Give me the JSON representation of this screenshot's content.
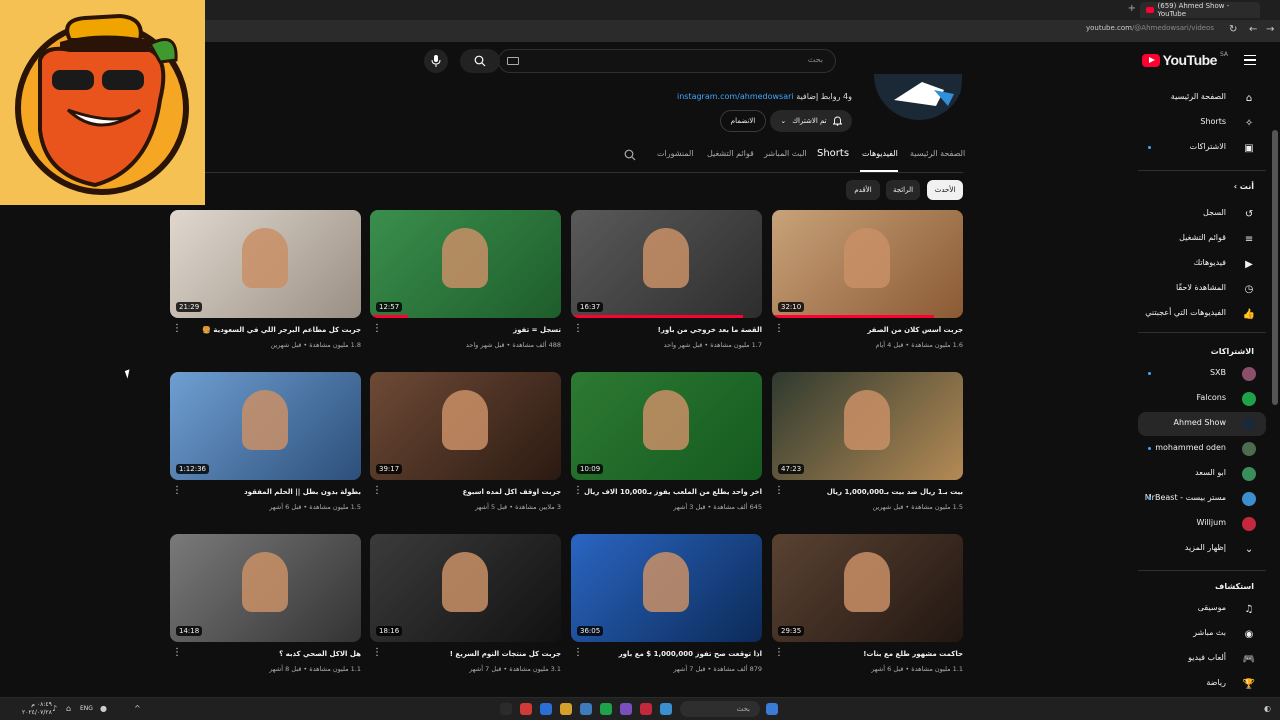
{
  "browser": {
    "tab_title": "(659) Ahmed Show - YouTube",
    "url_host": "youtube.com",
    "url_path": "/@Ahmedowsari/videos"
  },
  "masthead": {
    "logo_text": "YouTube",
    "logo_region": "SA",
    "search_placeholder": "بحث"
  },
  "channel": {
    "links_prefix": "و4 روابط إضافية",
    "link": "instagram.com/ahmedowsari",
    "subscribed_label": "تم الاشتراك",
    "join_label": "الانضمام"
  },
  "tabs": {
    "home": "الصفحة الرئيسية",
    "videos": "الفيديوهات",
    "shorts": "Shorts",
    "live": "البث المباشر",
    "playlists": "قوائم التشغيل",
    "posts": "المنشورات"
  },
  "chips": {
    "latest": "الأحدث",
    "popular": "الرائجة",
    "oldest": "الأقدم"
  },
  "colors": {
    "background": "#0f0f0f",
    "accent_red": "#ff0033",
    "link_blue": "#3ea6ff",
    "chip_bg": "#272727"
  },
  "videos": [
    {
      "title": "جربت أسس كلان من الصفر",
      "meta": "1.6 مليون مشاهدة • قبل 4 أيام",
      "duration": "32:10",
      "progress": 0.85
    },
    {
      "title": "القصة ما بعد خروجي من باور!",
      "meta": "1.7 مليون مشاهدة • قبل شهر واحد",
      "duration": "16:37",
      "progress": 0.9
    },
    {
      "title": "تسجل = تفوز",
      "meta": "488 ألف مشاهدة • قبل شهر واحد",
      "duration": "12:57",
      "progress": 0.2
    },
    {
      "title": "جربت كل مطاعم البرجر اللي في السعودية 🍔",
      "meta": "1.8 مليون مشاهدة • قبل شهرين",
      "duration": "21:29",
      "progress": 0.0
    },
    {
      "title": "بيت بـ1 ريال ضد بيت بـ1,000,000 ريال",
      "meta": "1.5 مليون مشاهدة • قبل شهرين",
      "duration": "47:23",
      "progress": 0.0
    },
    {
      "title": "آخر واحد يطلع من الملعب يفوز بـ10,000 آلاف ريال",
      "meta": "645 ألف مشاهدة • قبل 3 أشهر",
      "duration": "10:09",
      "progress": 0.0
    },
    {
      "title": "جربت اوقف اكل لمده اسبوع",
      "meta": "3 ملايين مشاهدة • قبل 5 أشهر",
      "duration": "39:17",
      "progress": 0.0
    },
    {
      "title": "بطولة بدون بطل || الحلم المفقود",
      "meta": "1.5 مليون مشاهدة • قبل 6 أشهر",
      "duration": "1:12:36",
      "progress": 0.0
    },
    {
      "title": "حاكمت مشهور طلع مع بنات!",
      "meta": "1.1 مليون مشاهدة • قبل 6 أشهر",
      "duration": "29:35",
      "progress": 0.0
    },
    {
      "title": "اذا توقعت صح تفوز 1,000,000 $ مع باور",
      "meta": "879 ألف مشاهدة • قبل 7 أشهر",
      "duration": "36:05",
      "progress": 0.0
    },
    {
      "title": "جربت كل منتجات النوم السريع !",
      "meta": "3.1 مليون مشاهدة • قبل 7 أشهر",
      "duration": "18:16",
      "progress": 0.0
    },
    {
      "title": "هل الاكل الصحي كذبه ؟",
      "meta": "1.1 مليون مشاهدة • قبل 8 أشهر",
      "duration": "14:18",
      "progress": 0.0
    }
  ],
  "sidebar": {
    "main": [
      {
        "label": "الصفحة الرئيسية",
        "icon": "home-icon"
      },
      {
        "label": "Shorts",
        "icon": "shorts-icon"
      },
      {
        "label": "الاشتراكات",
        "icon": "subscriptions-icon"
      }
    ],
    "you_header": "أنت",
    "you": [
      {
        "label": "السجل",
        "icon": "history-icon"
      },
      {
        "label": "قوائم التشغيل",
        "icon": "playlists-icon"
      },
      {
        "label": "فيديوهاتك",
        "icon": "your-videos-icon"
      },
      {
        "label": "المشاهدة لاحقًا",
        "icon": "watch-later-icon"
      },
      {
        "label": "الفيديوهات التي أعجبتني",
        "icon": "liked-icon"
      }
    ],
    "subs_header": "الاشتراكات",
    "subs": [
      {
        "label": "SXB",
        "color": "#8a4f6b"
      },
      {
        "label": "Falcons",
        "color": "#1fa34a"
      },
      {
        "label": "Ahmed Show",
        "color": "#1b2836"
      },
      {
        "label": "mohammed oden",
        "color": "#4d6b4f"
      },
      {
        "label": "ابو السعد",
        "color": "#3a8e5a"
      },
      {
        "label": "مستر بيست - MrBeast",
        "color": "#3c8fcf"
      },
      {
        "label": "Willjum",
        "color": "#c3283c"
      }
    ],
    "show_more": "إظهار المزيد",
    "explore_header": "استكشاف",
    "explore": [
      {
        "label": "موسيقى",
        "icon": "music-icon"
      },
      {
        "label": "بث مباشر",
        "icon": "live-icon"
      },
      {
        "label": "ألعاب فيديو",
        "icon": "gaming-icon"
      },
      {
        "label": "رياضة",
        "icon": "trophy-icon"
      }
    ]
  },
  "taskbar": {
    "search": "بحث",
    "time": "٠٨:٤٩ م",
    "date": "٢٠٢٤/٠٧/٢٨",
    "lang": "ENG"
  }
}
